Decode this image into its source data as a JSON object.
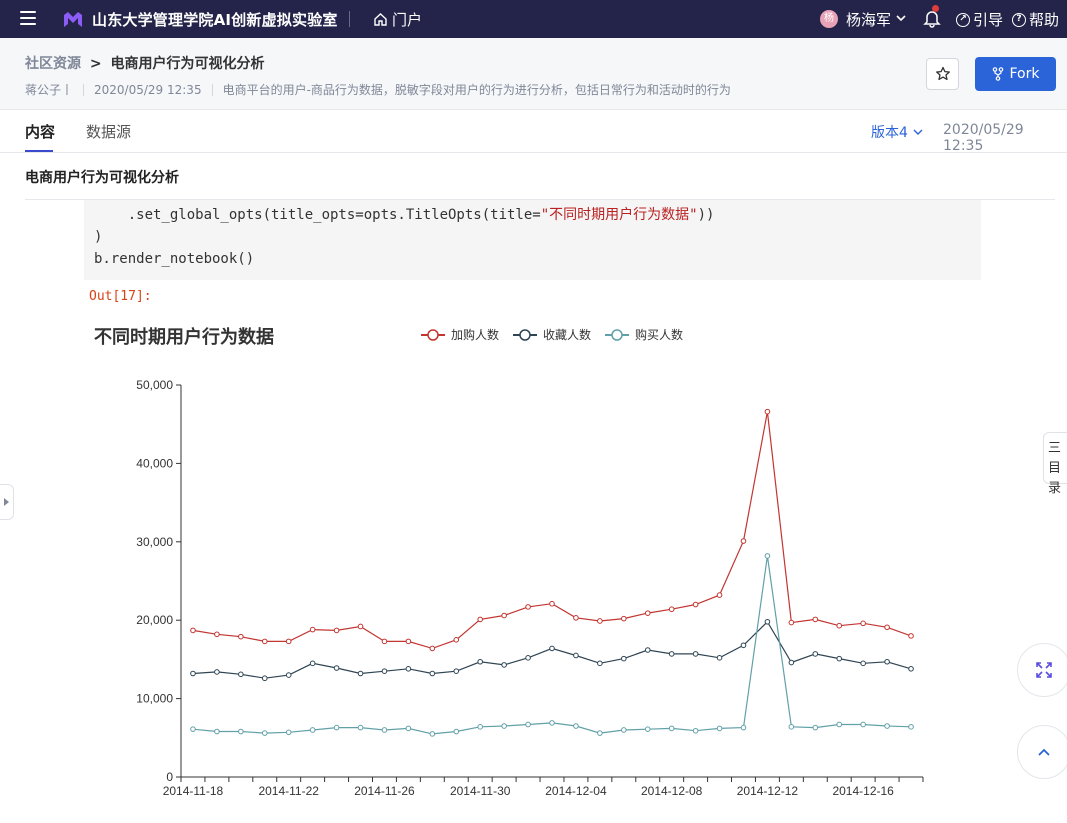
{
  "topbar": {
    "app_title": "山东大学管理学院AI创新虚拟实验室",
    "home_label": "门户",
    "avatar_char": "杨",
    "user_name": "杨海军",
    "guide_label": "引导",
    "help_label": "帮助"
  },
  "header": {
    "crumb_root": "社区资源",
    "crumb_sep": ">",
    "crumb_current": "电商用户行为可视化分析",
    "author": "蒋公子丨",
    "date": "2020/05/29 12:35",
    "description": "电商平台的用户-商品行为数据，脱敏字段对用户的行为进行分析，包括日常行为和活动时的行为",
    "fork_label": "Fork"
  },
  "tabs": {
    "items": [
      {
        "label": "内容",
        "active": true
      },
      {
        "label": "数据源",
        "active": false
      }
    ],
    "version_label": "版本4",
    "version_date": "2020/05/29 12:35"
  },
  "content": {
    "doc_title": "电商用户行为可视化分析",
    "code_lines": {
      "l1_pre": "    .set_global_opts(title_opts=opts.TitleOpts(title=",
      "l1_str": "\"不同时期用户行为数据\"",
      "l1_post": "))",
      "l2": ")",
      "l3": "b.render_notebook()"
    },
    "out_label": "Out[17]:",
    "toc_label_1": "三",
    "toc_label_2": "目录"
  },
  "chart_data": {
    "type": "line",
    "title": "不同时期用户行为数据",
    "legend_position": "top",
    "grid": false,
    "x": [
      "2014-11-18",
      "2014-11-19",
      "2014-11-20",
      "2014-11-21",
      "2014-11-22",
      "2014-11-23",
      "2014-11-24",
      "2014-11-25",
      "2014-11-26",
      "2014-11-27",
      "2014-11-28",
      "2014-11-29",
      "2014-11-30",
      "2014-12-01",
      "2014-12-02",
      "2014-12-03",
      "2014-12-04",
      "2014-12-05",
      "2014-12-06",
      "2014-12-07",
      "2014-12-08",
      "2014-12-09",
      "2014-12-10",
      "2014-12-11",
      "2014-12-12",
      "2014-12-13",
      "2014-12-14",
      "2014-12-15",
      "2014-12-16",
      "2014-12-17",
      "2014-12-18"
    ],
    "x_tick_labels": [
      "2014-11-18",
      "2014-11-22",
      "2014-11-26",
      "2014-11-30",
      "2014-12-04",
      "2014-12-08",
      "2014-12-12",
      "2014-12-16"
    ],
    "y_tick_labels": [
      "0",
      "10,000",
      "20,000",
      "30,000",
      "40,000",
      "50,000"
    ],
    "ylim": [
      0,
      50000
    ],
    "series": [
      {
        "name": "加购人数",
        "color": "#c23531",
        "values": [
          18700,
          18200,
          17900,
          17300,
          17300,
          18800,
          18700,
          19200,
          17300,
          17300,
          16400,
          17500,
          20100,
          20600,
          21700,
          22100,
          20300,
          19900,
          20200,
          20900,
          21400,
          22000,
          23200,
          30100,
          46600,
          19700,
          20100,
          19300,
          19600,
          19100,
          18000
        ]
      },
      {
        "name": "收藏人数",
        "color": "#2f4554",
        "values": [
          13200,
          13400,
          13100,
          12600,
          13000,
          14500,
          13900,
          13200,
          13500,
          13800,
          13200,
          13500,
          14700,
          14300,
          15200,
          16400,
          15500,
          14500,
          15100,
          16200,
          15700,
          15700,
          15200,
          16800,
          19800,
          14600,
          15700,
          15100,
          14500,
          14700,
          13800
        ]
      },
      {
        "name": "购买人数",
        "color": "#61a0a8",
        "values": [
          6100,
          5800,
          5800,
          5600,
          5700,
          6000,
          6300,
          6300,
          6000,
          6200,
          5500,
          5800,
          6400,
          6500,
          6700,
          6900,
          6500,
          5600,
          6000,
          6100,
          6200,
          5900,
          6200,
          6300,
          28200,
          6400,
          6300,
          6700,
          6700,
          6500,
          6400
        ]
      }
    ]
  }
}
